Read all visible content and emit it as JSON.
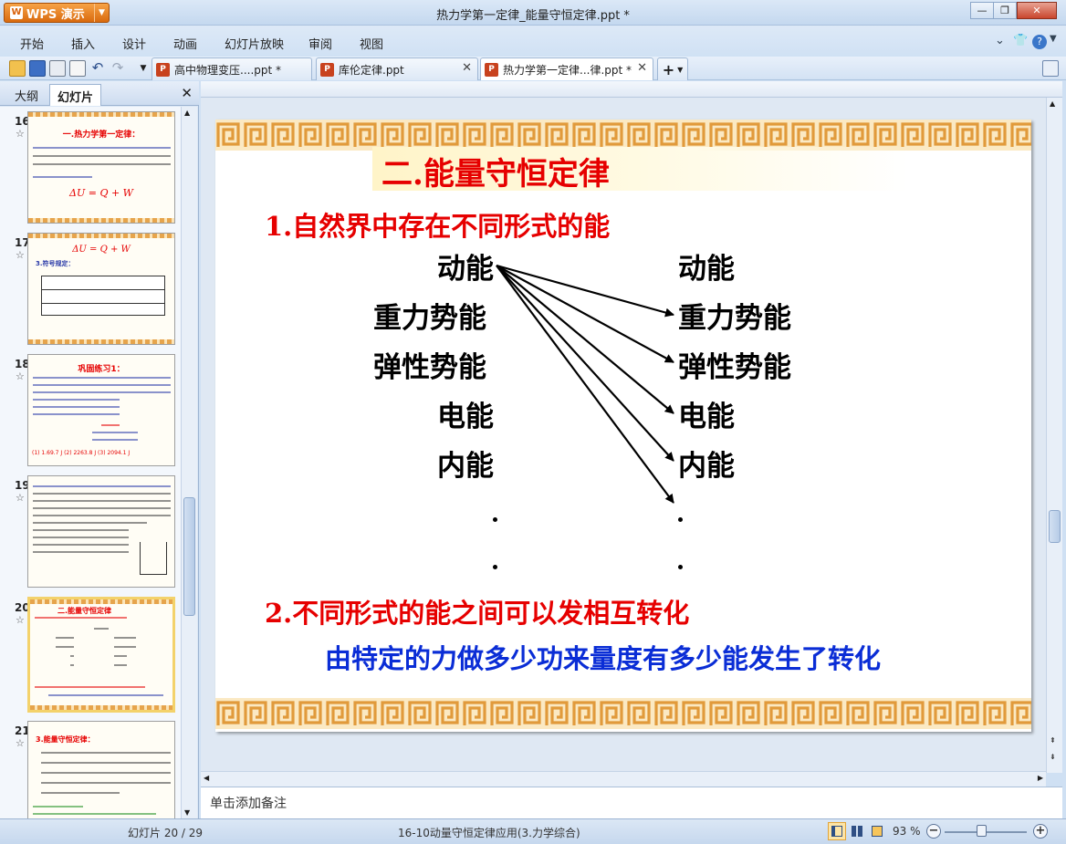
{
  "window": {
    "app_name": "WPS 演示",
    "title": "热力学第一定律_能量守恒定律.ppt *",
    "min_label": "▭",
    "max_label": "❐",
    "close_label": "✕"
  },
  "menu": {
    "items": [
      "开始",
      "插入",
      "设计",
      "动画",
      "幻灯片放映",
      "审阅",
      "视图"
    ],
    "right_icons": [
      "chevron-down-icon",
      "shirt-icon",
      "help-icon"
    ]
  },
  "toolbar": {
    "icons": [
      "open-icon",
      "save-icon",
      "print-icon",
      "print-preview-icon",
      "undo-icon",
      "redo-icon",
      "customize-icon"
    ]
  },
  "doc_tabs": [
    {
      "label": "高中物理变压....ppt *",
      "active": false
    },
    {
      "label": "库伦定律.ppt",
      "active": false
    },
    {
      "label": "热力学第一定律...律.ppt *",
      "active": true
    }
  ],
  "left_panel": {
    "tabs": [
      "大纲",
      "幻灯片"
    ],
    "close": "✕",
    "thumbnails": [
      {
        "num": "16",
        "selected": false,
        "title": "一.热力学第一定律：",
        "formula": "ΔU = Q + W"
      },
      {
        "num": "17",
        "selected": false,
        "title": "ΔU = Q + W",
        "sub": "3.符号规定："
      },
      {
        "num": "18",
        "selected": false,
        "title": "巩固练习1：",
        "footer": "(1) 1.69.7 J   (2) 2263.8 J   (3) 2094.1 J"
      },
      {
        "num": "19",
        "selected": false,
        "title": ""
      },
      {
        "num": "20",
        "selected": true,
        "title": "二.能量守恒定律"
      },
      {
        "num": "21",
        "selected": false,
        "title": "3.能量守恒定律："
      }
    ]
  },
  "slide": {
    "title": "二.能量守恒定律",
    "point1": "1.自然界中存在不同形式的能",
    "left_energies": [
      "动能",
      "重力势能",
      "弹性势能",
      "电能",
      "内能"
    ],
    "right_energies": [
      "动能",
      "重力势能",
      "弹性势能",
      "电能",
      "内能"
    ],
    "point2": "2.不同形式的能之间可以发相互转化",
    "point3": "由特定的力做多少功来量度有多少能发生了转化"
  },
  "notes": {
    "placeholder": "单击添加备注"
  },
  "status": {
    "slide_counter": "幻灯片 20 / 29",
    "template_name": "16-10动量守恒定律应用(3.力学综合)",
    "zoom": "93 %",
    "zoom_level": 0.46
  },
  "colors": {
    "title_red": "#e60000",
    "text_blue": "#0a2dd6",
    "key_border": "#e6a44c",
    "app_orange": "#d96a0e"
  }
}
